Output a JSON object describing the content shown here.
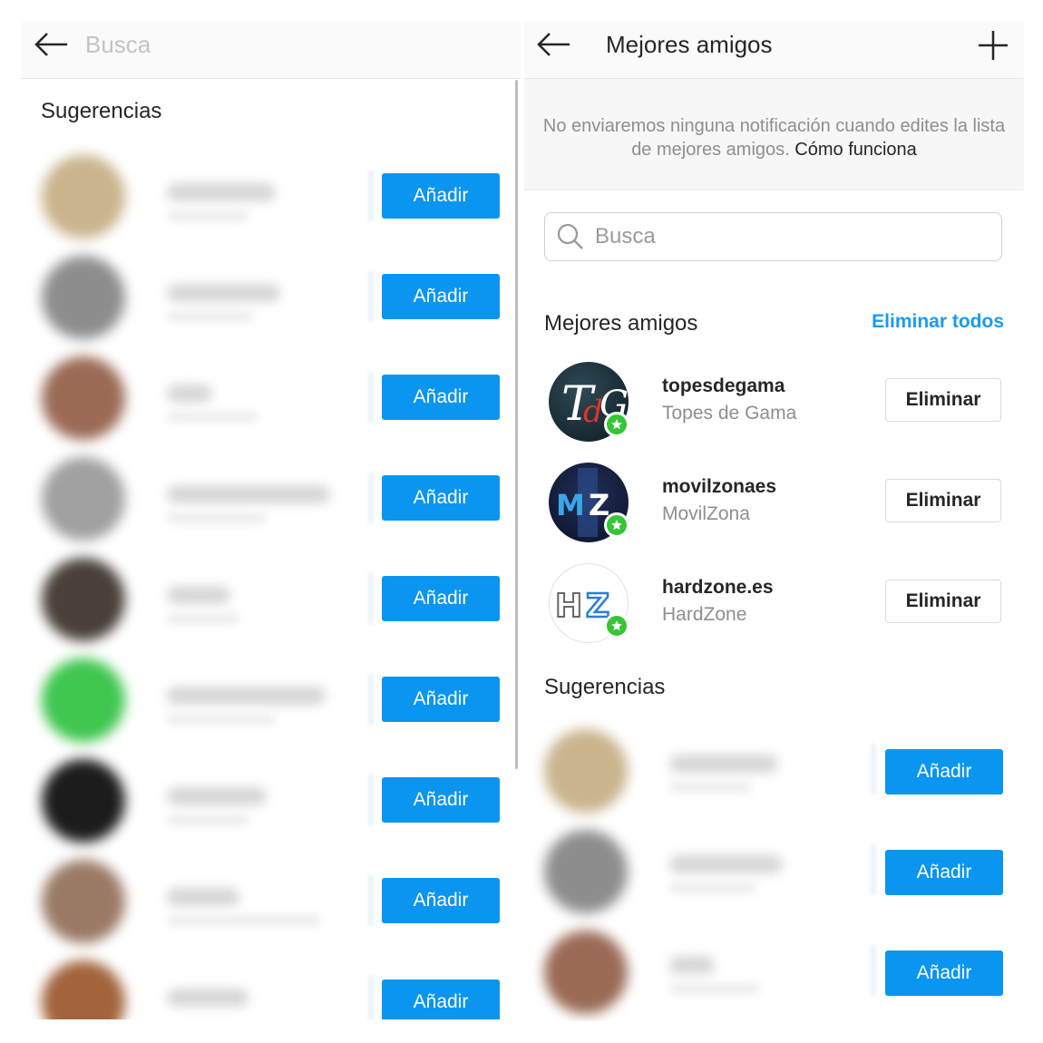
{
  "left_panel": {
    "search_placeholder": "Busca",
    "section_title": "Sugerencias",
    "suggestions": [
      {
        "button": "Añadir"
      },
      {
        "button": "Añadir"
      },
      {
        "button": "Añadir"
      },
      {
        "button": "Añadir"
      },
      {
        "button": "Añadir"
      },
      {
        "button": "Añadir"
      },
      {
        "button": "Añadir"
      },
      {
        "button": "Añadir"
      },
      {
        "button": "Añadir"
      }
    ]
  },
  "right_panel": {
    "title": "Mejores amigos",
    "notice_text": "No enviaremos ninguna notificación cuando edites la lista de mejores amigos.",
    "notice_link": "Cómo funciona",
    "search_placeholder": "Busca",
    "best_friends_title": "Mejores amigos",
    "remove_all": "Eliminar todos",
    "best_friends": [
      {
        "username": "topesdegama",
        "full_name": "Topes de Gama",
        "button": "Eliminar"
      },
      {
        "username": "movilzonaes",
        "full_name": "MovilZona",
        "button": "Eliminar"
      },
      {
        "username": "hardzone.es",
        "full_name": "HardZone",
        "button": "Eliminar"
      }
    ],
    "suggestions_title": "Sugerencias",
    "suggestions": [
      {
        "button": "Añadir"
      },
      {
        "button": "Añadir"
      },
      {
        "button": "Añadir"
      }
    ]
  },
  "colors": {
    "accent_blue": "#0a95f0",
    "link_blue": "#1a9bf0",
    "star_badge_green": "#35c535"
  },
  "icons": [
    "back-arrow-icon",
    "plus-icon",
    "search-icon",
    "star-icon"
  ]
}
